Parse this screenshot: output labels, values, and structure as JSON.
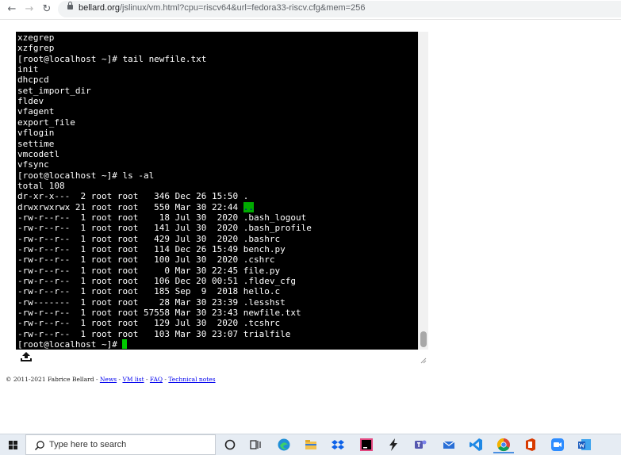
{
  "browser": {
    "url_host": "bellard.org",
    "url_path": "/jslinux/vm.html?cpu=riscv64&url=fedora33-riscv.cfg&mem=256"
  },
  "terminal": {
    "lines": [
      "xzegrep",
      "xzfgrep",
      "[root@localhost ~]# tail newfile.txt",
      "init",
      "dhcpcd",
      "set_import_dir",
      "fldev",
      "vfagent",
      "export_file",
      "vflogin",
      "settime",
      "vmcodetl",
      "vfsync",
      "[root@localhost ~]# ls -al",
      "total 108",
      "dr-xr-x---  2 root root   346 Dec 26 15:50 .",
      "drwxrwxrwx 21 root root   550 Mar 30 22:44 ",
      "-rw-r--r--  1 root root    18 Jul 30  2020 .bash_logout",
      "-rw-r--r--  1 root root   141 Jul 30  2020 .bash_profile",
      "-rw-r--r--  1 root root   429 Jul 30  2020 .bashrc",
      "-rw-r--r--  1 root root   114 Dec 26 15:49 bench.py",
      "-rw-r--r--  1 root root   100 Jul 30  2020 .cshrc",
      "-rw-r--r--  1 root root     0 Mar 30 22:45 file.py",
      "-rw-r--r--  1 root root   106 Dec 20 00:51 .fldev_cfg",
      "-rw-r--r--  1 root root   185 Sep  9  2018 hello.c",
      "-rw-------  1 root root    28 Mar 30 23:39 .lesshst",
      "-rw-r--r--  1 root root 57558 Mar 30 23:43 newfile.txt",
      "-rw-r--r--  1 root root   129 Jul 30  2020 .tcshrc",
      "-rw-r--r--  1 root root   103 Mar 30 23:07 trialfile",
      "[root@localhost ~]# "
    ],
    "parent_dir_entry": ".."
  },
  "footer": {
    "copyright": "© 2011-2021 Fabrice Bellard - ",
    "links": [
      "News",
      "VM list",
      "FAQ",
      "Technical notes"
    ],
    "separator": " - "
  },
  "taskbar": {
    "search_placeholder": "Type here to search"
  },
  "colors": {
    "terminal_bg": "#000000",
    "terminal_fg": "#ffffff",
    "cursor": "#00cc00",
    "taskbar_bg": "#e6ecf3"
  }
}
